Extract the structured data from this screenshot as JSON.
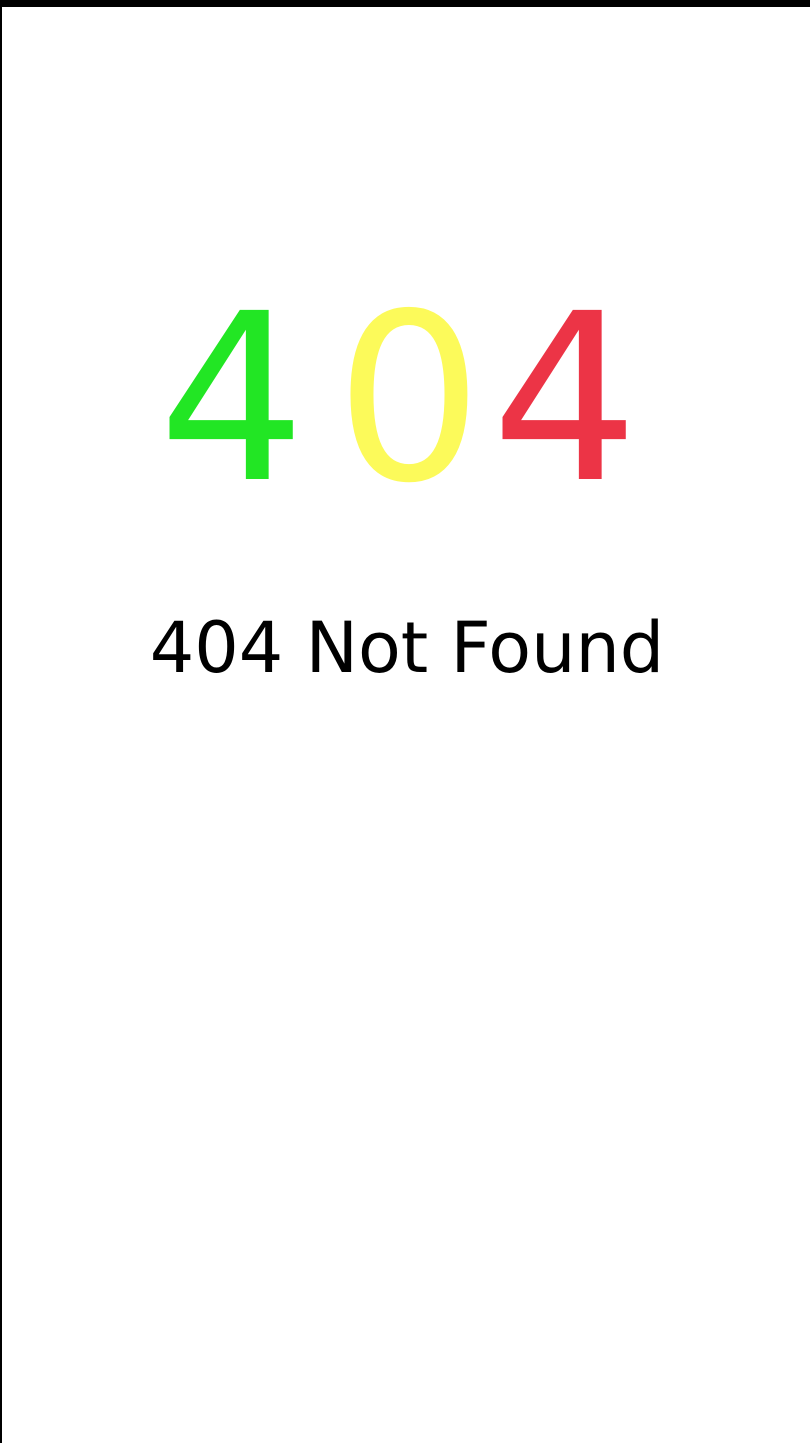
{
  "error_page": {
    "digits": [
      {
        "char": "4",
        "color": "#22e624"
      },
      {
        "char": "0",
        "color": "#fcfa5a"
      },
      {
        "char": "4",
        "color": "#ec3446"
      }
    ],
    "message": "404 Not Found"
  }
}
